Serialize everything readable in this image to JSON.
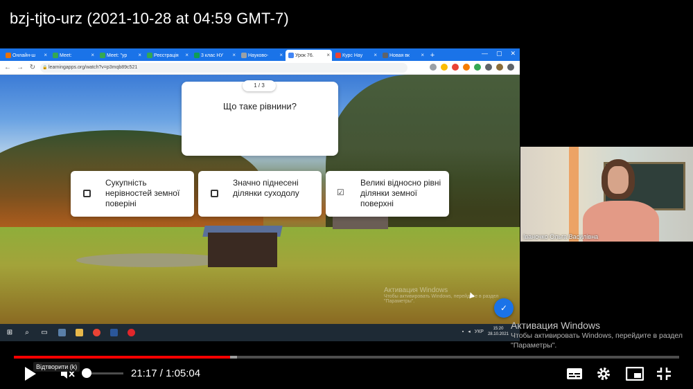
{
  "video": {
    "title": "bzj-tjto-urz (2021-10-28 at 04:59 GMT-7)"
  },
  "browser": {
    "tabs": [
      {
        "label": "Онлайн-ш",
        "color": "#e8710a"
      },
      {
        "label": "Meet:",
        "color": "#34a853"
      },
      {
        "label": "Meet: \"ур",
        "color": "#34a853"
      },
      {
        "label": "Реєстрація",
        "color": "#34a853"
      },
      {
        "label": "3 клас НУ",
        "color": "#0f9d58"
      },
      {
        "label": "Науково-",
        "color": "#9aa0a6"
      },
      {
        "label": "Урок 76.",
        "color": "#4285f4",
        "active": true
      },
      {
        "label": "Курс Нау",
        "color": "#ea4335"
      },
      {
        "label": "Новая вк",
        "color": "#5f6368"
      }
    ],
    "new_tab": "+",
    "url": "learningapps.org/watch?v=p3mqb89c521"
  },
  "quiz": {
    "counter": "1 / 3",
    "question": "Що таке рівнини?",
    "answers": [
      {
        "text": "Сукупність нерівностей земної поверіні",
        "checked": false
      },
      {
        "text": "Значно піднесені ділянки суходолу",
        "checked": false
      },
      {
        "text": "Великі відносно рівні ділянки земної поверхні",
        "checked": true
      }
    ]
  },
  "screen_watermark": {
    "title": "Активация Windows",
    "sub": "Чтобы активировать Windows, перейдите в раздел \"Параметры\"."
  },
  "taskbar": {
    "lang": "УКР",
    "time": "15:20",
    "date": "28.10.2021"
  },
  "webcam": {
    "name": "Іваночко Ольга Василівна"
  },
  "windows_watermark": {
    "title": "Активация Windows",
    "sub": "Чтобы активировать Windows, перейдите в раздел \"Параметры\"."
  },
  "player": {
    "tooltip": "Відтворити (k)",
    "time_current": "21:17",
    "time_separator": " / ",
    "time_total": "1:05:04",
    "progress_fraction": 0.325,
    "buffer_fraction": 0.335
  }
}
